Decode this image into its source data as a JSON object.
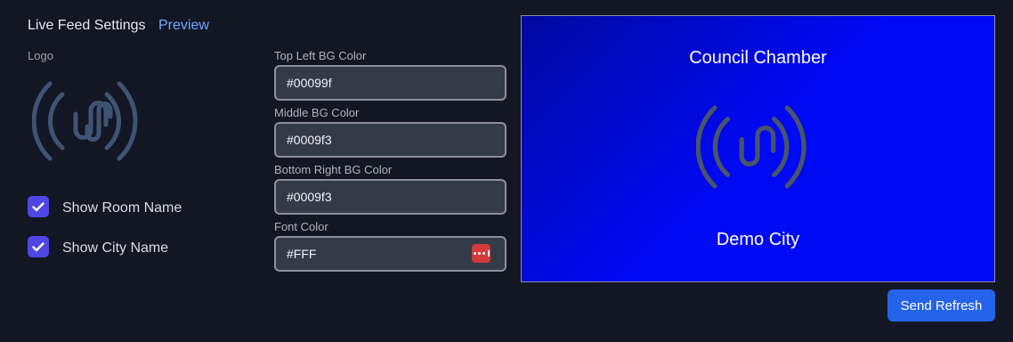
{
  "header": {
    "title": "Live Feed Settings",
    "preview_link": "Preview"
  },
  "logo": {
    "label": "Logo",
    "icon": "live-feed-logo-icon",
    "color": "#3f5373"
  },
  "options": [
    {
      "label": "Show Room Name",
      "checked": true
    },
    {
      "label": "Show City Name",
      "checked": true
    }
  ],
  "colors": {
    "top_left": {
      "label": "Top Left BG Color",
      "value": "#00099f"
    },
    "middle": {
      "label": "Middle BG Color",
      "value": "#0009f3"
    },
    "bottom_right": {
      "label": "Bottom Right BG Color",
      "value": "#0009f3"
    },
    "font": {
      "label": "Font Color",
      "value": "#FFF"
    },
    "accent": "#4f46e5",
    "button": "#2563eb"
  },
  "preview": {
    "room_name": "Council Chamber",
    "city_name": "Demo City",
    "logo_color": "#4a5468"
  },
  "actions": {
    "send_refresh": "Send Refresh"
  }
}
